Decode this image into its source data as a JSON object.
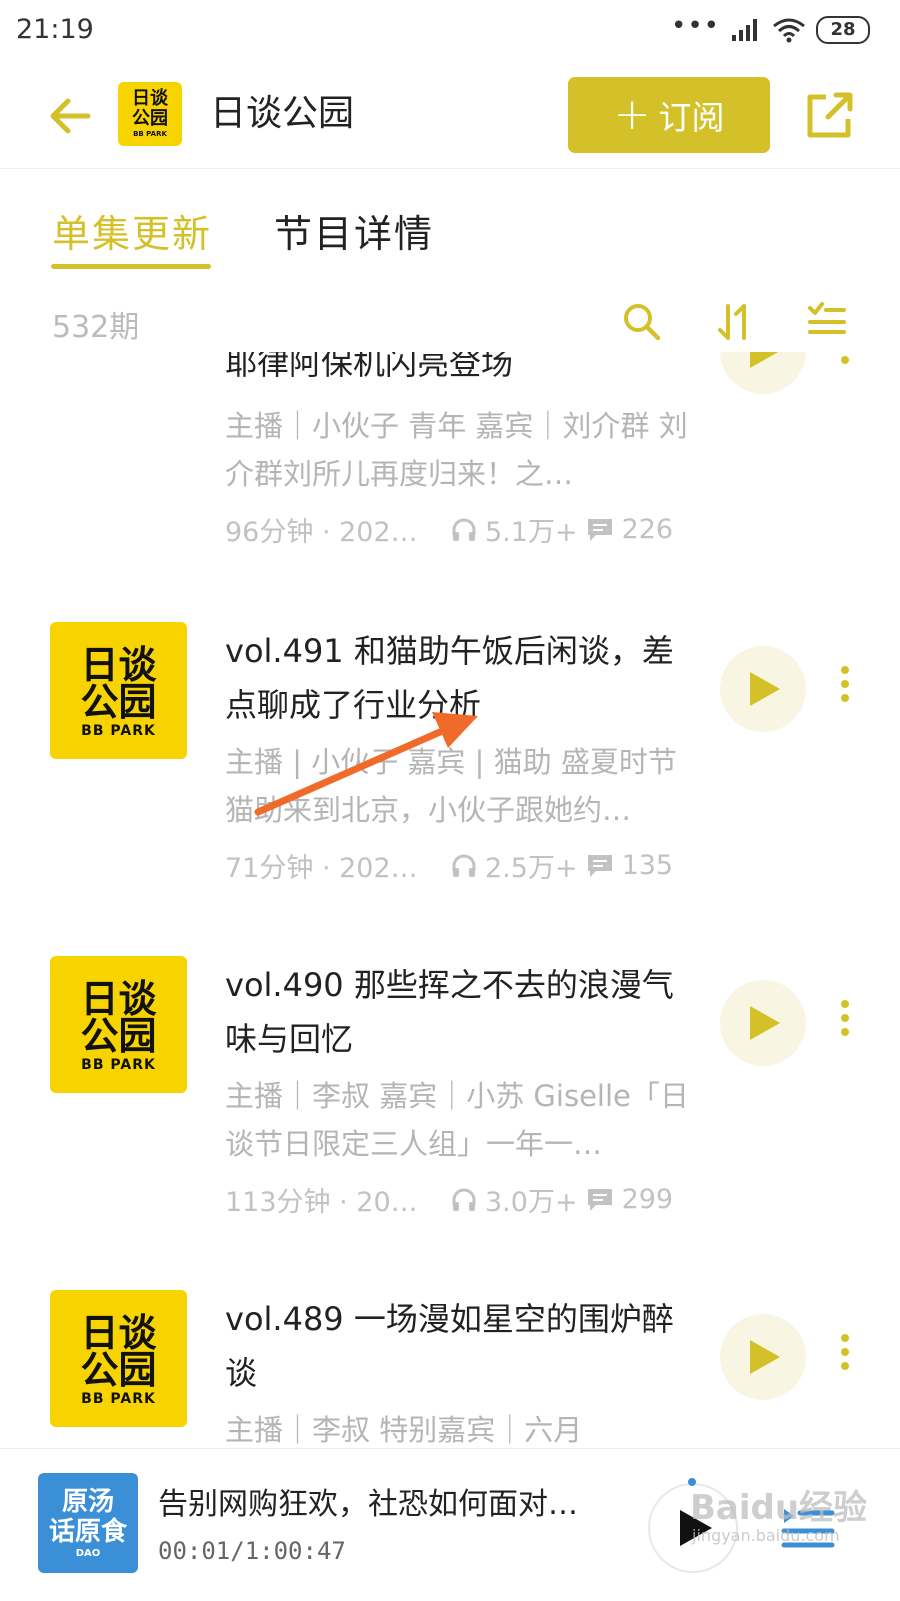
{
  "status": {
    "time": "21:19",
    "dots": "•••",
    "battery": "28"
  },
  "header": {
    "title": "日谈公园",
    "logo_line1": "日谈",
    "logo_line2": "公园",
    "logo_line3": "BB PARK",
    "subscribe_label": "订阅"
  },
  "tabs": [
    {
      "label": "单集更新",
      "active": true
    },
    {
      "label": "节目详情",
      "active": false
    }
  ],
  "list_header": {
    "count": "532期"
  },
  "cover_text": {
    "line1": "日谈",
    "line2": "公园",
    "line3": "BB PARK"
  },
  "episodes": [
    {
      "title": "耶律阿保机闪亮登场",
      "desc": "主播｜小伙子 青年 嘉宾｜刘介群 刘介群刘所儿再度归来！之…",
      "duration": "96分钟 · 2022...",
      "plays": "5.1万+",
      "comments": "226"
    },
    {
      "title": "vol.491 和猫助午饭后闲谈，差点聊成了行业分析",
      "desc": "主播 | 小伙子 嘉宾 | 猫助 盛夏时节猫助来到北京，小伙子跟她约…",
      "duration": "71分钟 · 2022...",
      "plays": "2.5万+",
      "comments": "135"
    },
    {
      "title": "vol.490 那些挥之不去的浪漫气味与回忆",
      "desc": "主播｜李叔 嘉宾｜小苏 Giselle「日谈节日限定三人组」一年一…",
      "duration": "113分钟 · 202...",
      "plays": "3.0万+",
      "comments": "299"
    },
    {
      "title": "vol.489 一场漫如星空的围炉醉谈",
      "desc": "主播｜李叔 特别嘉宾｜六月",
      "duration": "",
      "plays": "",
      "comments": ""
    }
  ],
  "player": {
    "title": "告别网购狂欢，社恐如何面对…",
    "time": "00:01/1:00:47",
    "cover_line1": "原汤",
    "cover_line2": "话原食",
    "cover_line3": "DAO"
  },
  "watermark": {
    "text": "Baidu经验",
    "sub": "jingyan.baidu.com"
  },
  "colors": {
    "accent": "#d4c12a",
    "cover_yellow": "#f7d300",
    "annotation_arrow": "#f06a2a"
  }
}
